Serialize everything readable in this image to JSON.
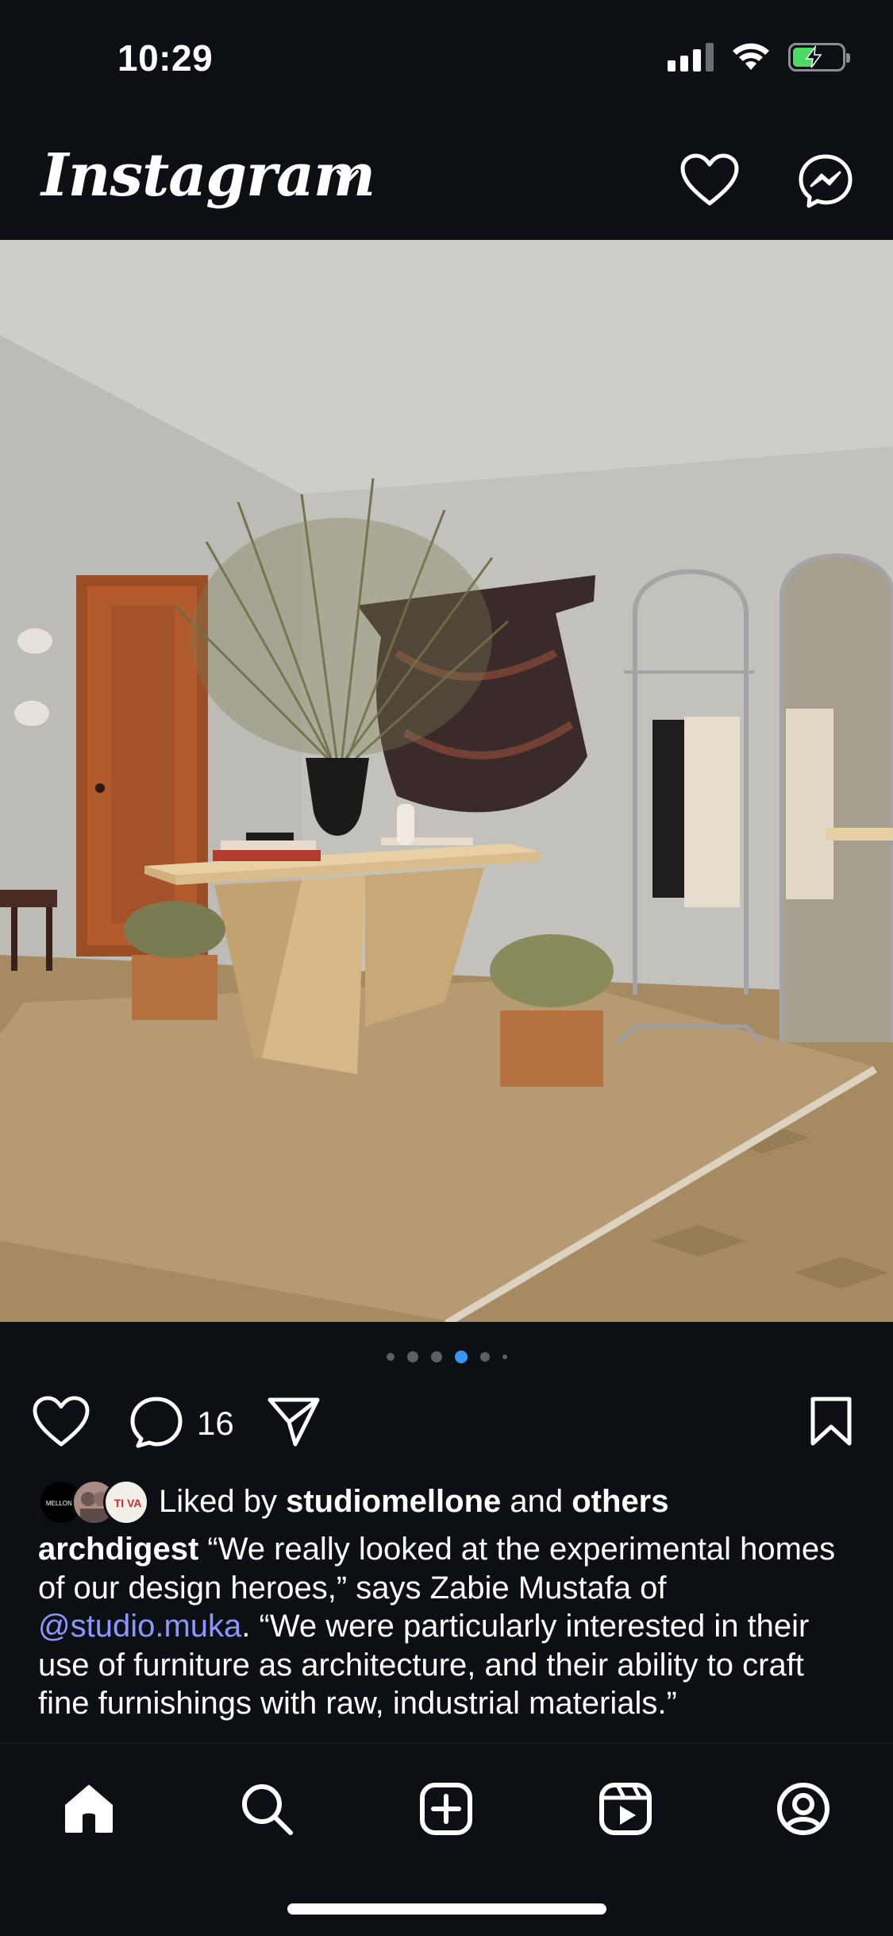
{
  "status_bar": {
    "time": "10:29",
    "battery_color": "#4cd964"
  },
  "header": {
    "app_name": "Instagram",
    "icons": [
      "chevron-down-icon",
      "heart-icon",
      "messenger-icon"
    ]
  },
  "post": {
    "carousel": {
      "count": 6,
      "active_index": 3,
      "accent": "#3897f0"
    },
    "comment_count": "16",
    "likes": {
      "prefix": "Liked by",
      "user": "studiomellone",
      "middle": "and",
      "others": "others",
      "avatar_labels": [
        "MELLONE",
        "TI VA"
      ]
    },
    "caption": {
      "author": "archdigest",
      "text_1": " “We really looked at the experimental homes of our design heroes,” says Zabie Mustafa of ",
      "mention": "@studio.muka",
      "text_2": ". “We were particularly interested in their use of furniture as architecture, and their ability to craft fine furnishings with raw, industrial materials.”",
      "mention_color": "#8c96ff"
    }
  },
  "bottom_nav": {
    "items": [
      "home-icon",
      "search-icon",
      "create-icon",
      "reels-icon",
      "profile-icon"
    ]
  }
}
